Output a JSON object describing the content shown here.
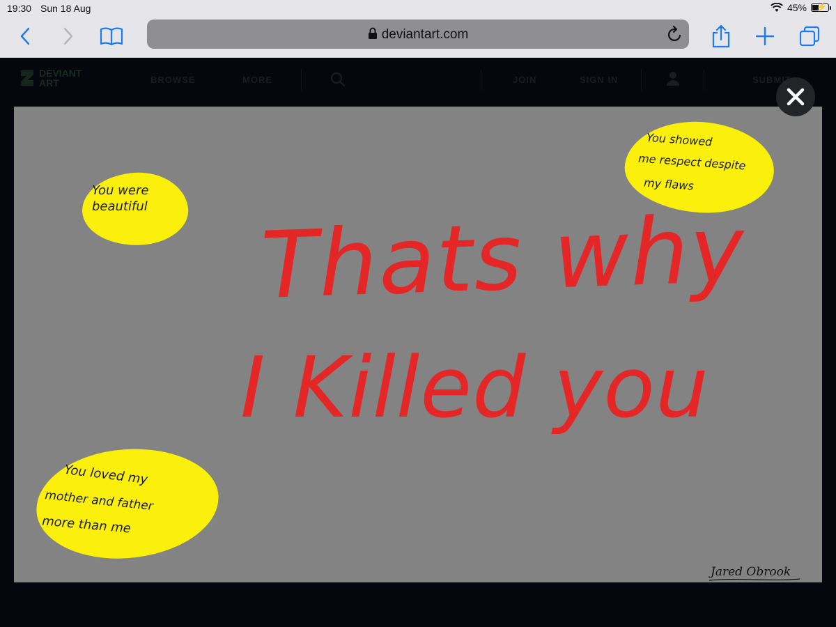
{
  "status_bar": {
    "time": "19:30",
    "date": "Sun 18 Aug",
    "battery_percent": "45%",
    "battery_level": 0.45
  },
  "toolbar": {
    "url": "deviantart.com",
    "icons": [
      "back-icon",
      "forward-icon",
      "bookmarks-icon",
      "lock-icon",
      "reload-icon",
      "share-icon",
      "new-tab-icon",
      "tabs-icon"
    ]
  },
  "site_header": {
    "logo_line1": "DEVIANT",
    "logo_line2": "ART",
    "browse": "BROWSE",
    "more": "MORE",
    "join": "JOIN",
    "sign_in": "SIGN IN",
    "submit": "SUBMIT"
  },
  "artwork": {
    "main_line1": "Thats why",
    "main_line2": "I Killed you",
    "bubble_top_left": "You were beautiful",
    "bubble_top_right_line1": "You showed",
    "bubble_top_right_line2": "me respect despite",
    "bubble_top_right_line3": "my flaws",
    "bubble_bottom_left_line1": "You loved my",
    "bubble_bottom_left_line2": "mother and father",
    "bubble_bottom_left_line3": "more than me",
    "signature": "Jared Obrook",
    "colors": {
      "background": "#838383",
      "bubble": "#fbf00b",
      "main_text": "#e52626"
    }
  }
}
